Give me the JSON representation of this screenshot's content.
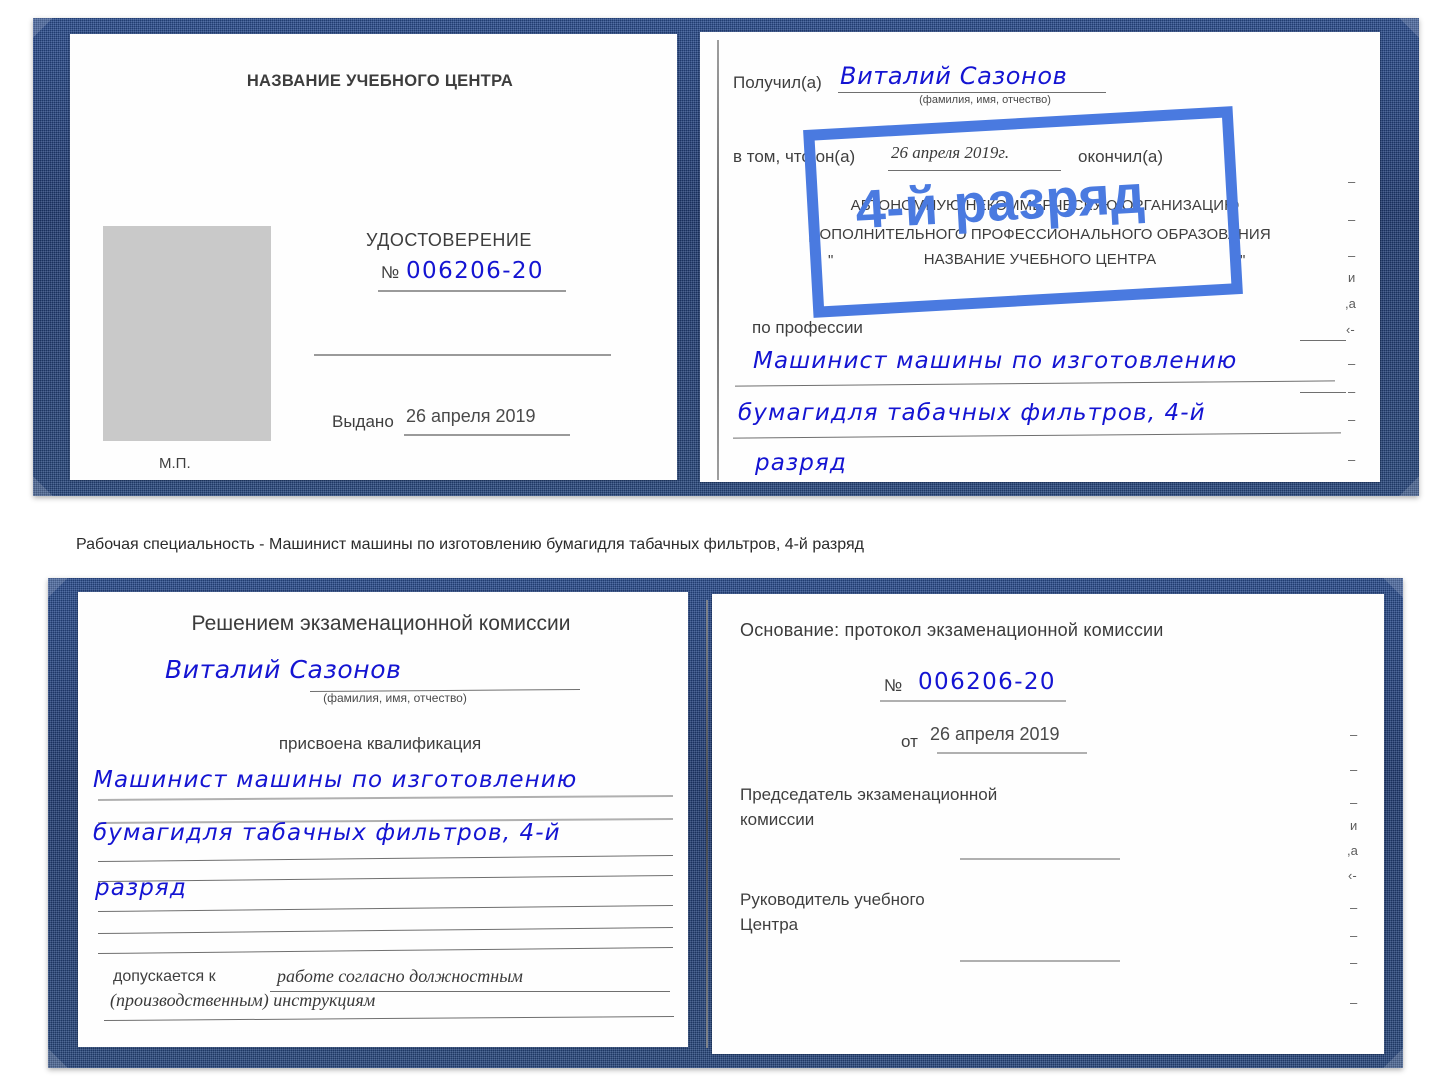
{
  "caption": {
    "text": "Рабочая специальность - Машинист машины по изготовлению бумагидля табачных фильтров, 4-й разряд"
  },
  "colors": {
    "cover_blue": "#27477e",
    "handwriting_blue": "#1414d2",
    "stamp_blue": "#4a7ae0",
    "paper_white": "#fefefe",
    "photo_gray": "#c9c9c9",
    "rule_gray": "#9a9a9a"
  },
  "certificate_top": {
    "left_page": {
      "heading": "НАЗВАНИЕ УЧЕБНОГО ЦЕНТРА",
      "doc_type": "УДОСТОВЕРЕНИЕ",
      "number_label": "№",
      "number_value": "006206-20",
      "issued_label": "Выдано",
      "issued_value": "26 апреля 2019",
      "seal_label": "М.П.",
      "photo_placeholder": "photo-placeholder"
    },
    "right_page": {
      "received_label": "Получил(а)",
      "received_value": "Виталий Сазонов",
      "name_hint": "(фамилия, имя, отчество)",
      "in_that_label": "в том, что он(а)",
      "completion_date": "26 апреля 2019г.",
      "finished_label": "окончил(а)",
      "org_line_1": "АВТОНОМНУЮ НЕКОММЕРЧЕСКУЮ ОРГАНИЗАЦИЮ",
      "org_line_2": "ДОПОЛНИТЕЛЬНОГО ПРОФЕССИОНАЛЬНОГО ОБРАЗОВАНИЯ",
      "org_quote_open": "\"",
      "org_name": "НАЗВАНИЕ УЧЕБНОГО ЦЕНТРА",
      "org_quote_close": "\"",
      "profession_label": "по профессии",
      "profession_line_1": "Машинист машины по изготовлению",
      "profession_line_2": "бумагидля табачных фильтров, 4-й",
      "profession_line_3": "разряд",
      "stamp_text": "4-й разряд",
      "edge_marks": [
        "–",
        "–",
        "–",
        "и",
        "̦а",
        "‹-",
        "–",
        "–",
        "–",
        "–"
      ]
    }
  },
  "certificate_bottom": {
    "left_page": {
      "heading": "Решением экзаменационной комиссии",
      "name_value": "Виталий Сазонов",
      "name_hint": "(фамилия, имя, отчество)",
      "qualification_label": "присвоена квалификация",
      "qualification_line_1": "Машинист машины по изготовлению",
      "qualification_line_2": "бумагидля табачных фильтров, 4-й",
      "qualification_line_3": "разряд",
      "admitted_label": "допускается к",
      "admitted_value_line_1": "работе согласно должностным",
      "admitted_value_line_2": "(производственным) инструкциям"
    },
    "right_page": {
      "basis_label": "Основание: протокол экзаменационной комиссии",
      "number_label": "№",
      "number_value": "006206-20",
      "date_label": "от",
      "date_value": "26 апреля 2019",
      "chairman_line_1": "Председатель экзаменационной",
      "chairman_line_2": "комиссии",
      "head_line_1": "Руководитель учебного",
      "head_line_2": "Центра",
      "edge_marks": [
        "–",
        "–",
        "–",
        "и",
        "̦а",
        "‹-",
        "–",
        "–",
        "–",
        "–"
      ]
    }
  }
}
